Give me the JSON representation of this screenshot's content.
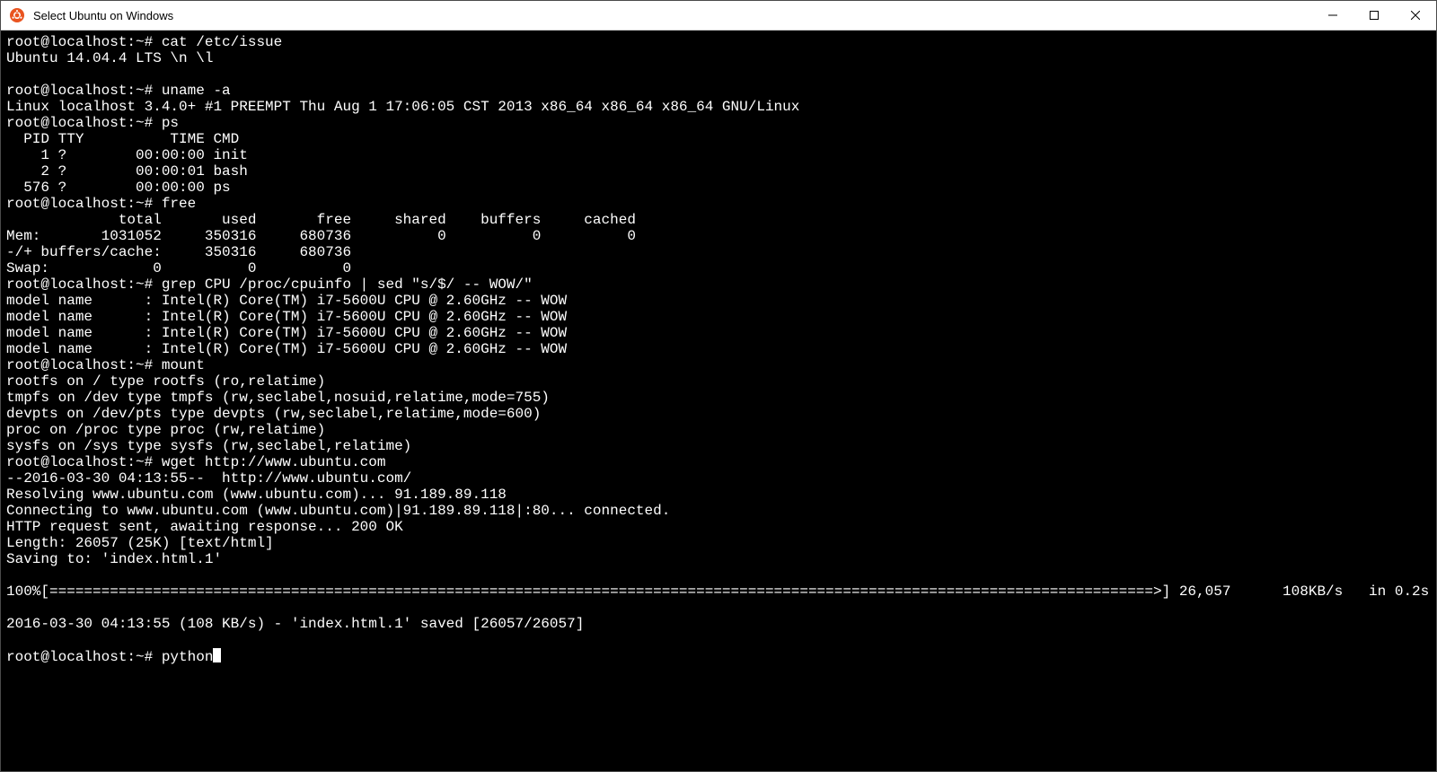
{
  "window": {
    "title": "Select Ubuntu on Windows"
  },
  "prompt": "root@localhost:~# ",
  "current_input": "python",
  "lines": [
    "root@localhost:~# cat /etc/issue",
    "Ubuntu 14.04.4 LTS \\n \\l",
    "",
    "root@localhost:~# uname -a",
    "Linux localhost 3.4.0+ #1 PREEMPT Thu Aug 1 17:06:05 CST 2013 x86_64 x86_64 x86_64 GNU/Linux",
    "root@localhost:~# ps",
    "  PID TTY          TIME CMD",
    "    1 ?        00:00:00 init",
    "    2 ?        00:00:01 bash",
    "  576 ?        00:00:00 ps",
    "root@localhost:~# free",
    "             total       used       free     shared    buffers     cached",
    "Mem:       1031052     350316     680736          0          0          0",
    "-/+ buffers/cache:     350316     680736",
    "Swap:            0          0          0",
    "root@localhost:~# grep CPU /proc/cpuinfo | sed \"s/$/ -- WOW/\"",
    "model name      : Intel(R) Core(TM) i7-5600U CPU @ 2.60GHz -- WOW",
    "model name      : Intel(R) Core(TM) i7-5600U CPU @ 2.60GHz -- WOW",
    "model name      : Intel(R) Core(TM) i7-5600U CPU @ 2.60GHz -- WOW",
    "model name      : Intel(R) Core(TM) i7-5600U CPU @ 2.60GHz -- WOW",
    "root@localhost:~# mount",
    "rootfs on / type rootfs (ro,relatime)",
    "tmpfs on /dev type tmpfs (rw,seclabel,nosuid,relatime,mode=755)",
    "devpts on /dev/pts type devpts (rw,seclabel,relatime,mode=600)",
    "proc on /proc type proc (rw,relatime)",
    "sysfs on /sys type sysfs (rw,seclabel,relatime)",
    "root@localhost:~# wget http://www.ubuntu.com",
    "--2016-03-30 04:13:55--  http://www.ubuntu.com/",
    "Resolving www.ubuntu.com (www.ubuntu.com)... 91.189.89.118",
    "Connecting to www.ubuntu.com (www.ubuntu.com)|91.189.89.118|:80... connected.",
    "HTTP request sent, awaiting response... 200 OK",
    "Length: 26057 (25K) [text/html]",
    "Saving to: 'index.html.1'",
    ""
  ],
  "progress": {
    "percent": "100%",
    "size": "26,057",
    "speed": "108KB/s",
    "eta": "in 0.2s"
  },
  "saved_line": "2016-03-30 04:13:55 (108 KB/s) - 'index.html.1' saved [26057/26057]"
}
